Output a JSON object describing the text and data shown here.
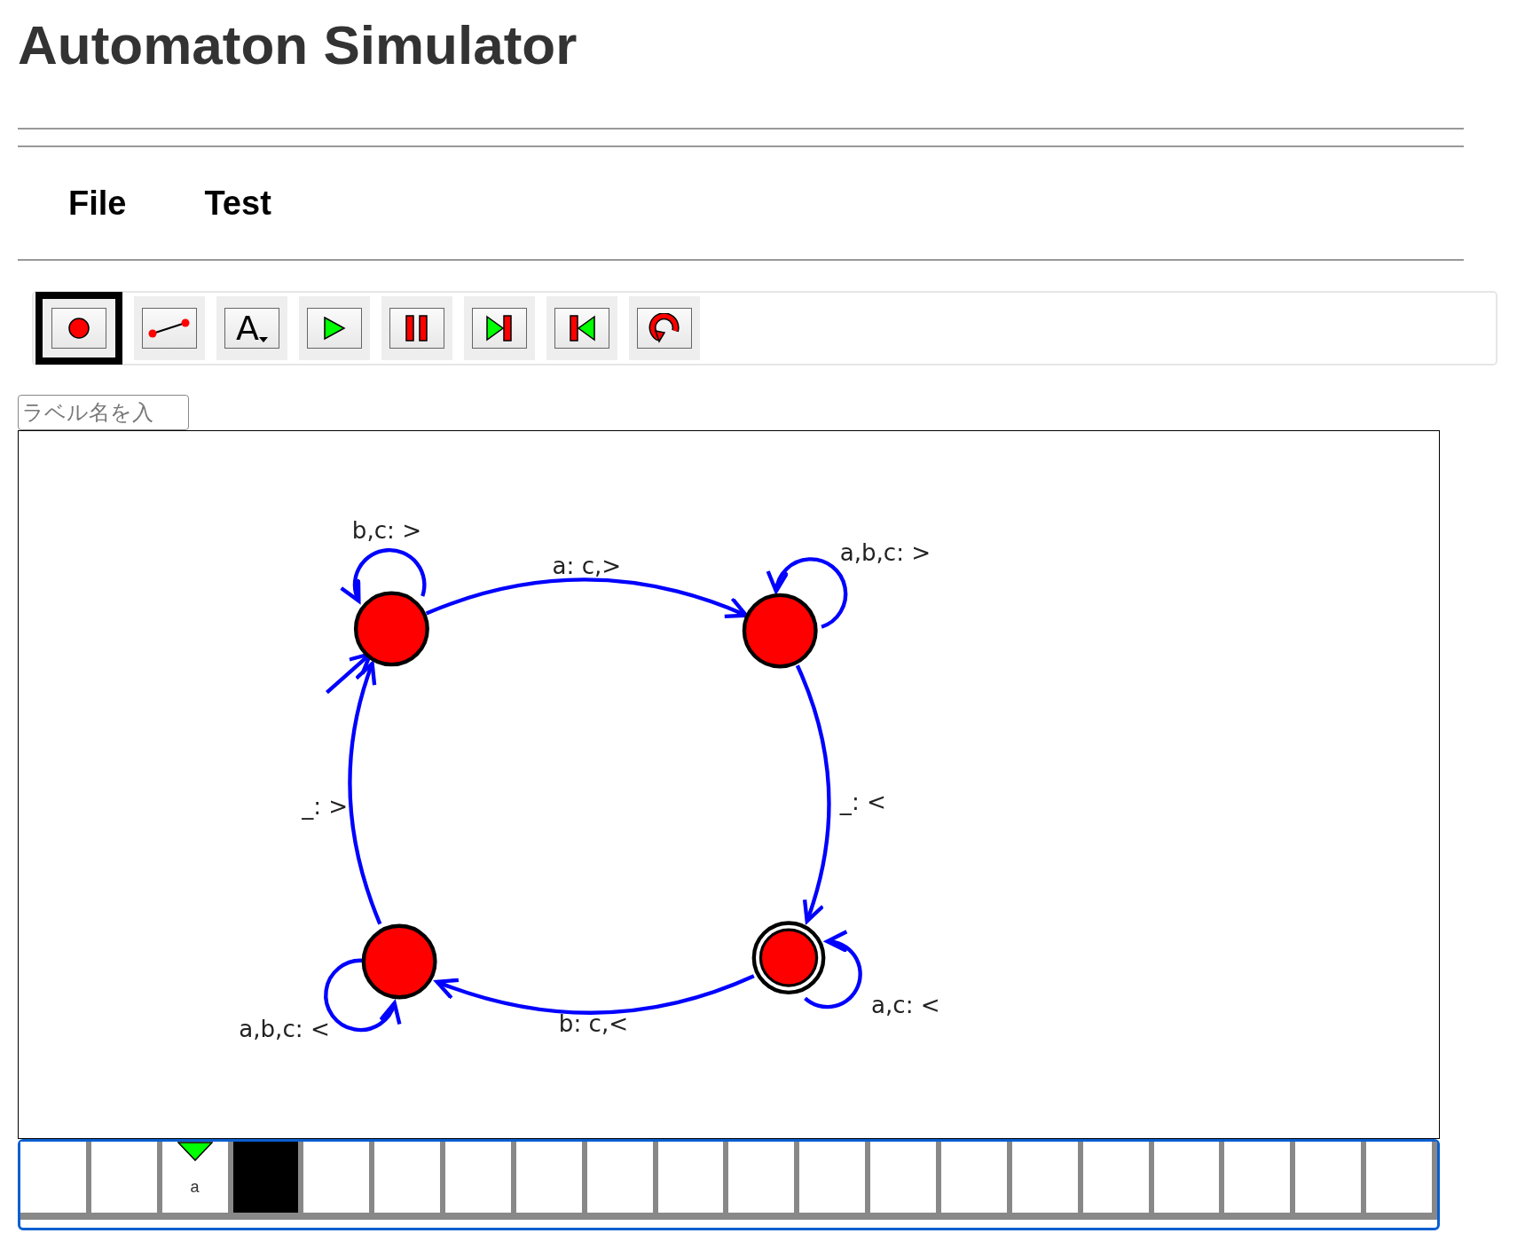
{
  "title": "Automaton Simulator",
  "menu": [
    {
      "label": "File"
    },
    {
      "label": "Test"
    }
  ],
  "toolbar": [
    {
      "kind": "state",
      "selected": true
    },
    {
      "kind": "transition",
      "selected": false
    },
    {
      "kind": "label",
      "glyph": "A",
      "selected": false
    },
    {
      "kind": "play",
      "selected": false
    },
    {
      "kind": "pause",
      "selected": false
    },
    {
      "kind": "step-forward",
      "selected": false
    },
    {
      "kind": "step-back",
      "selected": false
    },
    {
      "kind": "reset",
      "selected": false
    }
  ],
  "label_field": {
    "placeholder": "ラベル名を入"
  },
  "states": [
    {
      "initial": true,
      "accepting": false
    },
    {
      "initial": false,
      "accepting": false
    },
    {
      "initial": false,
      "accepting": true
    },
    {
      "initial": false,
      "accepting": false
    }
  ],
  "transitions": [
    {
      "label": "b,c: >"
    },
    {
      "label": "a: c,>"
    },
    {
      "label": "a,b,c: >"
    },
    {
      "label": "_: <"
    },
    {
      "label": "a,c: <"
    },
    {
      "label": "b: c,<"
    },
    {
      "label": "a,b,c: <"
    },
    {
      "label": "_: >"
    }
  ],
  "tape": [
    {
      "head": false,
      "filled": false
    },
    {
      "head": false,
      "filled": false
    },
    {
      "head": true,
      "filled": false,
      "symbol": "a"
    },
    {
      "head": false,
      "filled": true
    },
    {
      "head": false,
      "filled": false
    },
    {
      "head": false,
      "filled": false
    },
    {
      "head": false,
      "filled": false
    },
    {
      "head": false,
      "filled": false
    },
    {
      "head": false,
      "filled": false
    },
    {
      "head": false,
      "filled": false
    },
    {
      "head": false,
      "filled": false
    },
    {
      "head": false,
      "filled": false
    },
    {
      "head": false,
      "filled": false
    },
    {
      "head": false,
      "filled": false
    },
    {
      "head": false,
      "filled": false
    },
    {
      "head": false,
      "filled": false
    },
    {
      "head": false,
      "filled": false
    },
    {
      "head": false,
      "filled": false
    },
    {
      "head": false,
      "filled": false
    },
    {
      "head": false,
      "filled": false
    }
  ]
}
